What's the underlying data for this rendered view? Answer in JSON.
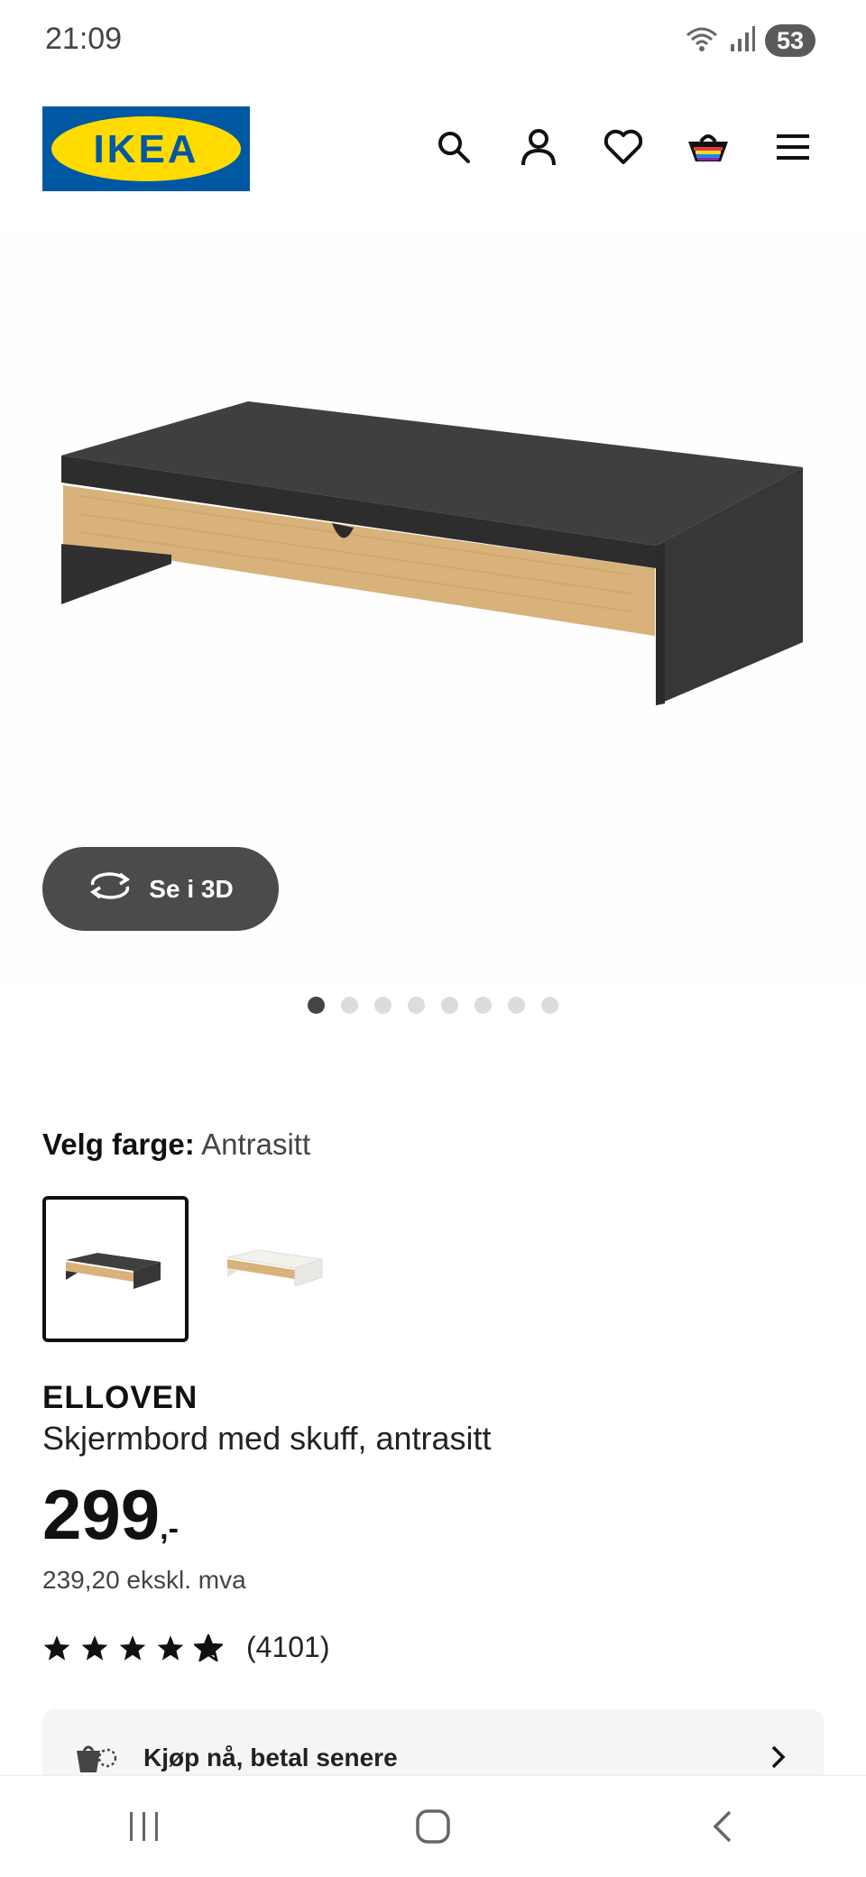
{
  "status_bar": {
    "time": "21:09",
    "battery": "53",
    "wifi_badge": "5"
  },
  "header": {
    "logo_text": "IKEA",
    "icons": [
      "search-icon",
      "user-icon",
      "heart-icon",
      "basket-icon",
      "menu-icon"
    ]
  },
  "gallery": {
    "view_3d_label": "Se i 3D",
    "dot_count": 8,
    "active_dot": 0
  },
  "color_picker": {
    "label": "Velg farge:",
    "selected_value": "Antrasitt",
    "options": [
      "Antrasitt",
      "Hvit"
    ]
  },
  "product": {
    "name": "ELLOVEN",
    "description": "Skjermbord med skuff, antrasitt",
    "price": "299",
    "price_suffix": ",-",
    "price_ex_vat": "239,20 ekskl. mva",
    "rating": 4.7,
    "review_count": "(4101)"
  },
  "payment": {
    "label": "Kjøp nå, betal senere"
  },
  "colors": {
    "ikea_blue": "#0058A3",
    "ikea_yellow": "#FFDB00",
    "dark_button": "#4B4B4B",
    "anthracite": "#3E3F3E",
    "bamboo": "#D8B27A"
  }
}
